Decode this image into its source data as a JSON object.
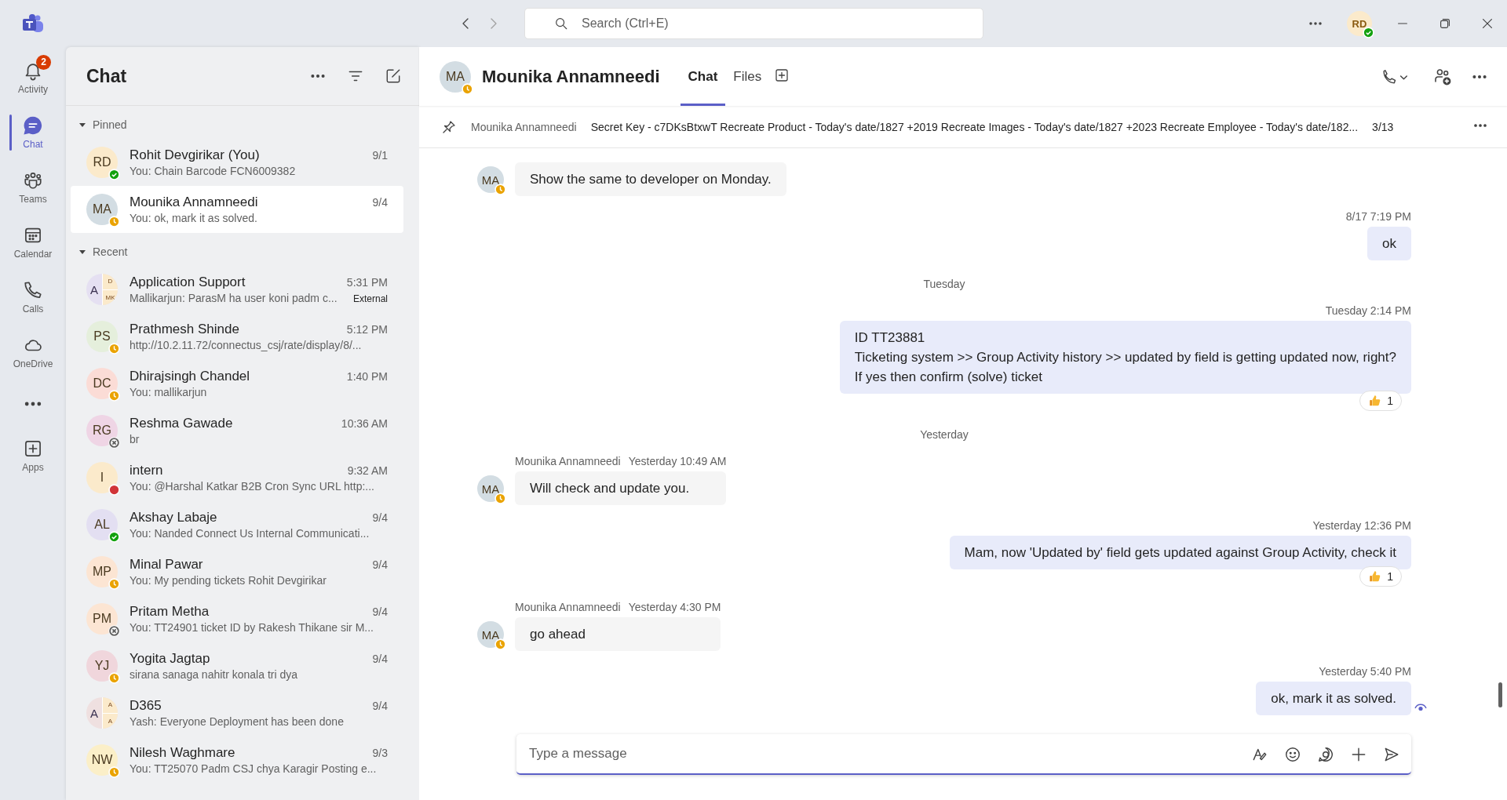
{
  "app_bar": {
    "search": {
      "placeholder": "Search (Ctrl+E)"
    },
    "user": {
      "initials": "RD",
      "status": {
        "kind": "available",
        "color": "#13a10e"
      }
    }
  },
  "rail": [
    {
      "label": "Activity",
      "badge": "2",
      "selected": false
    },
    {
      "label": "Chat",
      "selected": true
    },
    {
      "label": "Teams",
      "selected": false
    },
    {
      "label": "Calendar",
      "selected": false
    },
    {
      "label": "Calls",
      "selected": false
    },
    {
      "label": "OneDrive",
      "selected": false
    },
    {
      "kind": "more",
      "selected": false
    },
    {
      "label": "Apps",
      "selected": false
    }
  ],
  "chat_list": {
    "title": "Chat",
    "sections": [
      {
        "label": "Pinned",
        "expanded": true,
        "chats": [
          {
            "initials": "RD",
            "color": "#fbeacb",
            "status": {
              "kind": "available",
              "color": "#13a10e"
            },
            "name": "Rohit Devgirikar (You)",
            "time": "9/1",
            "preview": "You: Chain Barcode FCN6009382",
            "selected": false
          },
          {
            "initials": "MA",
            "color": "#d3dde3",
            "status": {
              "kind": "away",
              "color": "#eaa300"
            },
            "name": "Mounika Annamneedi",
            "time": "9/4",
            "preview": "You: ok, mark it as solved.",
            "selected": true
          }
        ]
      },
      {
        "label": "Recent",
        "expanded": true,
        "chats": [
          {
            "kind": "group",
            "initials": "A",
            "sub_initials": [
              "D",
              "MK"
            ],
            "color": "#e5e0f2",
            "name": "Application Support",
            "time": "5:31 PM",
            "preview": "Mallikarjun: ParasM ha user koni padm c...",
            "tag": "External",
            "selected": false
          },
          {
            "initials": "PS",
            "color": "#e5efdc",
            "status": {
              "kind": "away",
              "color": "#eaa300"
            },
            "name": "Prathmesh Shinde",
            "time": "5:12 PM",
            "preview": "http://10.2.11.72/connectus_csj/rate/display/8/...",
            "selected": false
          },
          {
            "initials": "DC",
            "color": "#fbdcd6",
            "status": {
              "kind": "away",
              "color": "#eaa300"
            },
            "name": "Dhirajsingh Chandel",
            "time": "1:40 PM",
            "preview": "You: mallikarjun",
            "selected": false
          },
          {
            "initials": "RG",
            "color": "#efd5e5",
            "status": {
              "kind": "offline",
              "color": "#616161"
            },
            "name": "Reshma Gawade",
            "time": "10:36 AM",
            "preview": "br",
            "selected": false
          },
          {
            "initials": "I",
            "color": "#fbeacb",
            "status": {
              "kind": "busy",
              "color": "#d13438"
            },
            "name": "intern",
            "time": "9:32 AM",
            "preview": "You: @Harshal Katkar  B2B Cron Sync URL http:...",
            "selected": false
          },
          {
            "initials": "AL",
            "color": "#e3dff2",
            "status": {
              "kind": "available",
              "color": "#13a10e"
            },
            "name": "Akshay Labaje",
            "time": "9/4",
            "preview": "You: Nanded Connect Us Internal Communicati...",
            "selected": false
          },
          {
            "initials": "MP",
            "color": "#fce5d3",
            "status": {
              "kind": "away",
              "color": "#eaa300"
            },
            "name": "Minal Pawar",
            "time": "9/4",
            "preview": "You: My pending tickets Rohit Devgirikar",
            "selected": false
          },
          {
            "initials": "PM",
            "color": "#fce5d3",
            "status": {
              "kind": "offline",
              "color": "#616161"
            },
            "name": "Pritam Metha",
            "time": "9/4",
            "preview": "You: TT24901 ticket ID by Rakesh Thikane sir M...",
            "selected": false
          },
          {
            "initials": "YJ",
            "color": "#f0d6dc",
            "status": {
              "kind": "away",
              "color": "#eaa300"
            },
            "name": "Yogita Jagtap",
            "time": "9/4",
            "preview": "sirana sanaga nahitr konala tri dya",
            "selected": false
          },
          {
            "kind": "group",
            "initials": "A",
            "sub_initials": [
              "A",
              "A"
            ],
            "color": "#efe0e0",
            "name": "D365",
            "time": "9/4",
            "preview": "Yash: Everyone Deployment has been done",
            "selected": false
          },
          {
            "initials": "NW",
            "color": "#fbefc8",
            "status": {
              "kind": "away",
              "color": "#eaa300"
            },
            "name": "Nilesh Waghmare",
            "time": "9/3",
            "preview": "You: TT25070 Padm CSJ chya Karagir Posting e...",
            "selected": false
          }
        ]
      }
    ]
  },
  "conversation": {
    "initials": "MA",
    "status": {
      "kind": "away",
      "color": "#eaa300"
    },
    "name": "Mounika Annamneedi",
    "tabs": [
      {
        "label": "Chat",
        "selected": true
      },
      {
        "label": "Files",
        "selected": false
      }
    ],
    "pinned": {
      "author": "Mounika Annamneedi",
      "text": "Secret Key - c7DKsBtxwT Recreate Product - Today's date/1827 +2019 Recreate Images - Today's date/1827 +2023 Recreate Employee - Today's date/182...",
      "count": "3/13"
    },
    "messages": [
      {
        "kind": "incoming",
        "initials": "MA",
        "status": {
          "kind": "away",
          "color": "#eaa300"
        },
        "text": "Show the same to developer on Monday."
      },
      {
        "kind": "outgoing",
        "time": "8/17 7:19 PM",
        "text": "ok"
      },
      {
        "kind": "divider",
        "text": "Tuesday"
      },
      {
        "kind": "outgoing",
        "time": "Tuesday 2:14 PM",
        "text": "ID TT23881\nTicketing system >> Group Activity history >> updated by field is getting updated now, right?\nIf yes then confirm (solve) ticket",
        "reaction": {
          "count": "1"
        }
      },
      {
        "kind": "divider",
        "text": "Yesterday"
      },
      {
        "kind": "incoming",
        "initials": "MA",
        "status": {
          "kind": "away",
          "color": "#eaa300"
        },
        "sender": "Mounika Annamneedi",
        "time": "Yesterday 10:49 AM",
        "text": "Will check and update you."
      },
      {
        "kind": "outgoing",
        "time": "Yesterday 12:36 PM",
        "text": "Mam, now 'Updated by' field gets updated against Group Activity, check it",
        "reaction": {
          "count": "1"
        }
      },
      {
        "kind": "incoming",
        "initials": "MA",
        "status": {
          "kind": "away",
          "color": "#eaa300"
        },
        "sender": "Mounika Annamneedi",
        "time": "Yesterday 4:30 PM",
        "text": "go ahead"
      },
      {
        "kind": "outgoing",
        "time": "Yesterday 5:40 PM",
        "text": "ok, mark it as solved.",
        "seen": true
      }
    ],
    "compose": {
      "placeholder": "Type a message"
    }
  }
}
